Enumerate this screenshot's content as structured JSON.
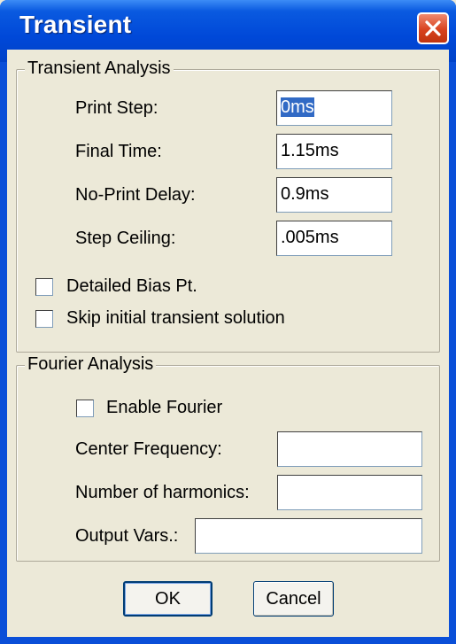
{
  "window": {
    "title": "Transient"
  },
  "transient": {
    "legend": "Transient Analysis",
    "print_step_label": "Print Step:",
    "print_step_value": "0ms",
    "final_time_label": "Final Time:",
    "final_time_value": "1.15ms",
    "no_print_delay_label": "No-Print Delay:",
    "no_print_delay_value": "0.9ms",
    "step_ceiling_label": "Step Ceiling:",
    "step_ceiling_value": ".005ms",
    "detailed_bias_label": "Detailed Bias Pt.",
    "detailed_bias_checked": false,
    "skip_initial_label": "Skip initial transient solution",
    "skip_initial_checked": false
  },
  "fourier": {
    "legend": "Fourier Analysis",
    "enable_label": "Enable Fourier",
    "enable_checked": false,
    "center_freq_label": "Center Frequency:",
    "center_freq_value": "",
    "harmonics_label": "Number of harmonics:",
    "harmonics_value": "",
    "output_vars_label": "Output Vars.:",
    "output_vars_value": ""
  },
  "buttons": {
    "ok_label": "OK",
    "cancel_label": "Cancel"
  },
  "icons": {
    "close": "close-icon"
  },
  "colors": {
    "titlebar": "#0054e3",
    "close_button": "#d8421e",
    "dialog_bg": "#ece9d8",
    "selection": "#316ac5"
  }
}
